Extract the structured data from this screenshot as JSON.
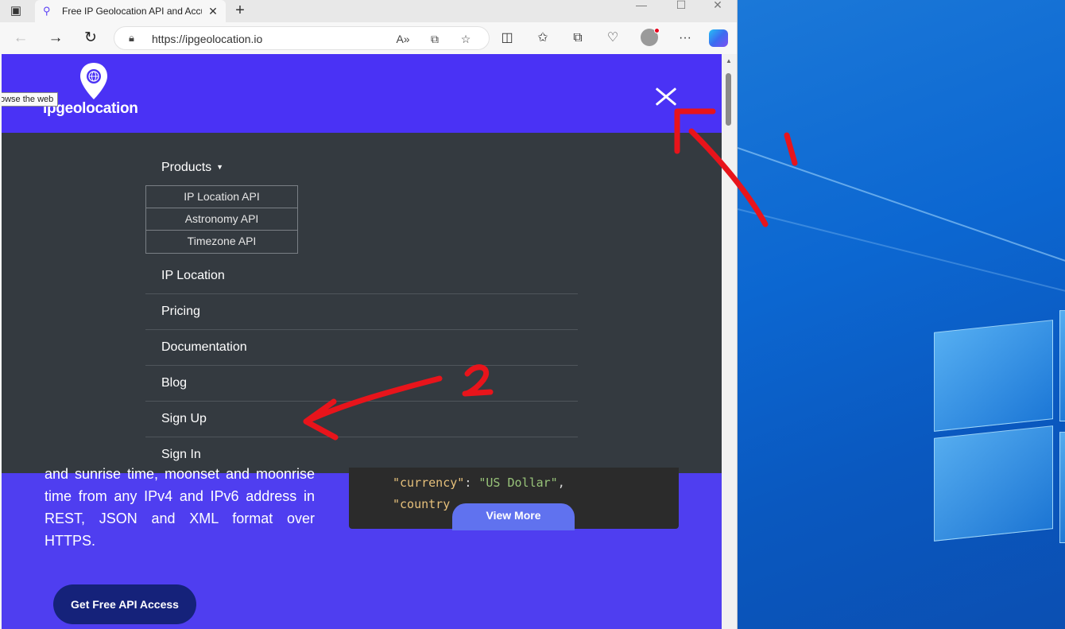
{
  "browser": {
    "tab_title": "Free IP Geolocation API and Accu",
    "url": "https://ipgeolocation.io",
    "tooltip": "owse the web"
  },
  "site": {
    "logo_text": "ipgeolocation",
    "menu": {
      "products_label": "Products",
      "products_submenu": [
        "IP Location API",
        "Astronomy API",
        "Timezone API"
      ],
      "items": [
        "IP Location",
        "Pricing",
        "Documentation",
        "Blog",
        "Sign Up",
        "Sign In"
      ]
    },
    "hero_text": "and sunrise time, moonset and moonrise time from any IPv4 and IPv6 address in REST, JSON and XML format over HTTPS.",
    "code": {
      "line1_key": "\"currency\"",
      "line1_punc": ": ",
      "line1_val": "\"US Dollar\"",
      "line1_end": ",",
      "line2_key": "\"country"
    },
    "view_more_label": "View More",
    "cta_label": "Get Free API Access"
  },
  "annotations": {
    "label_1": "1",
    "label_2": "2",
    "color": "#e8141b"
  }
}
